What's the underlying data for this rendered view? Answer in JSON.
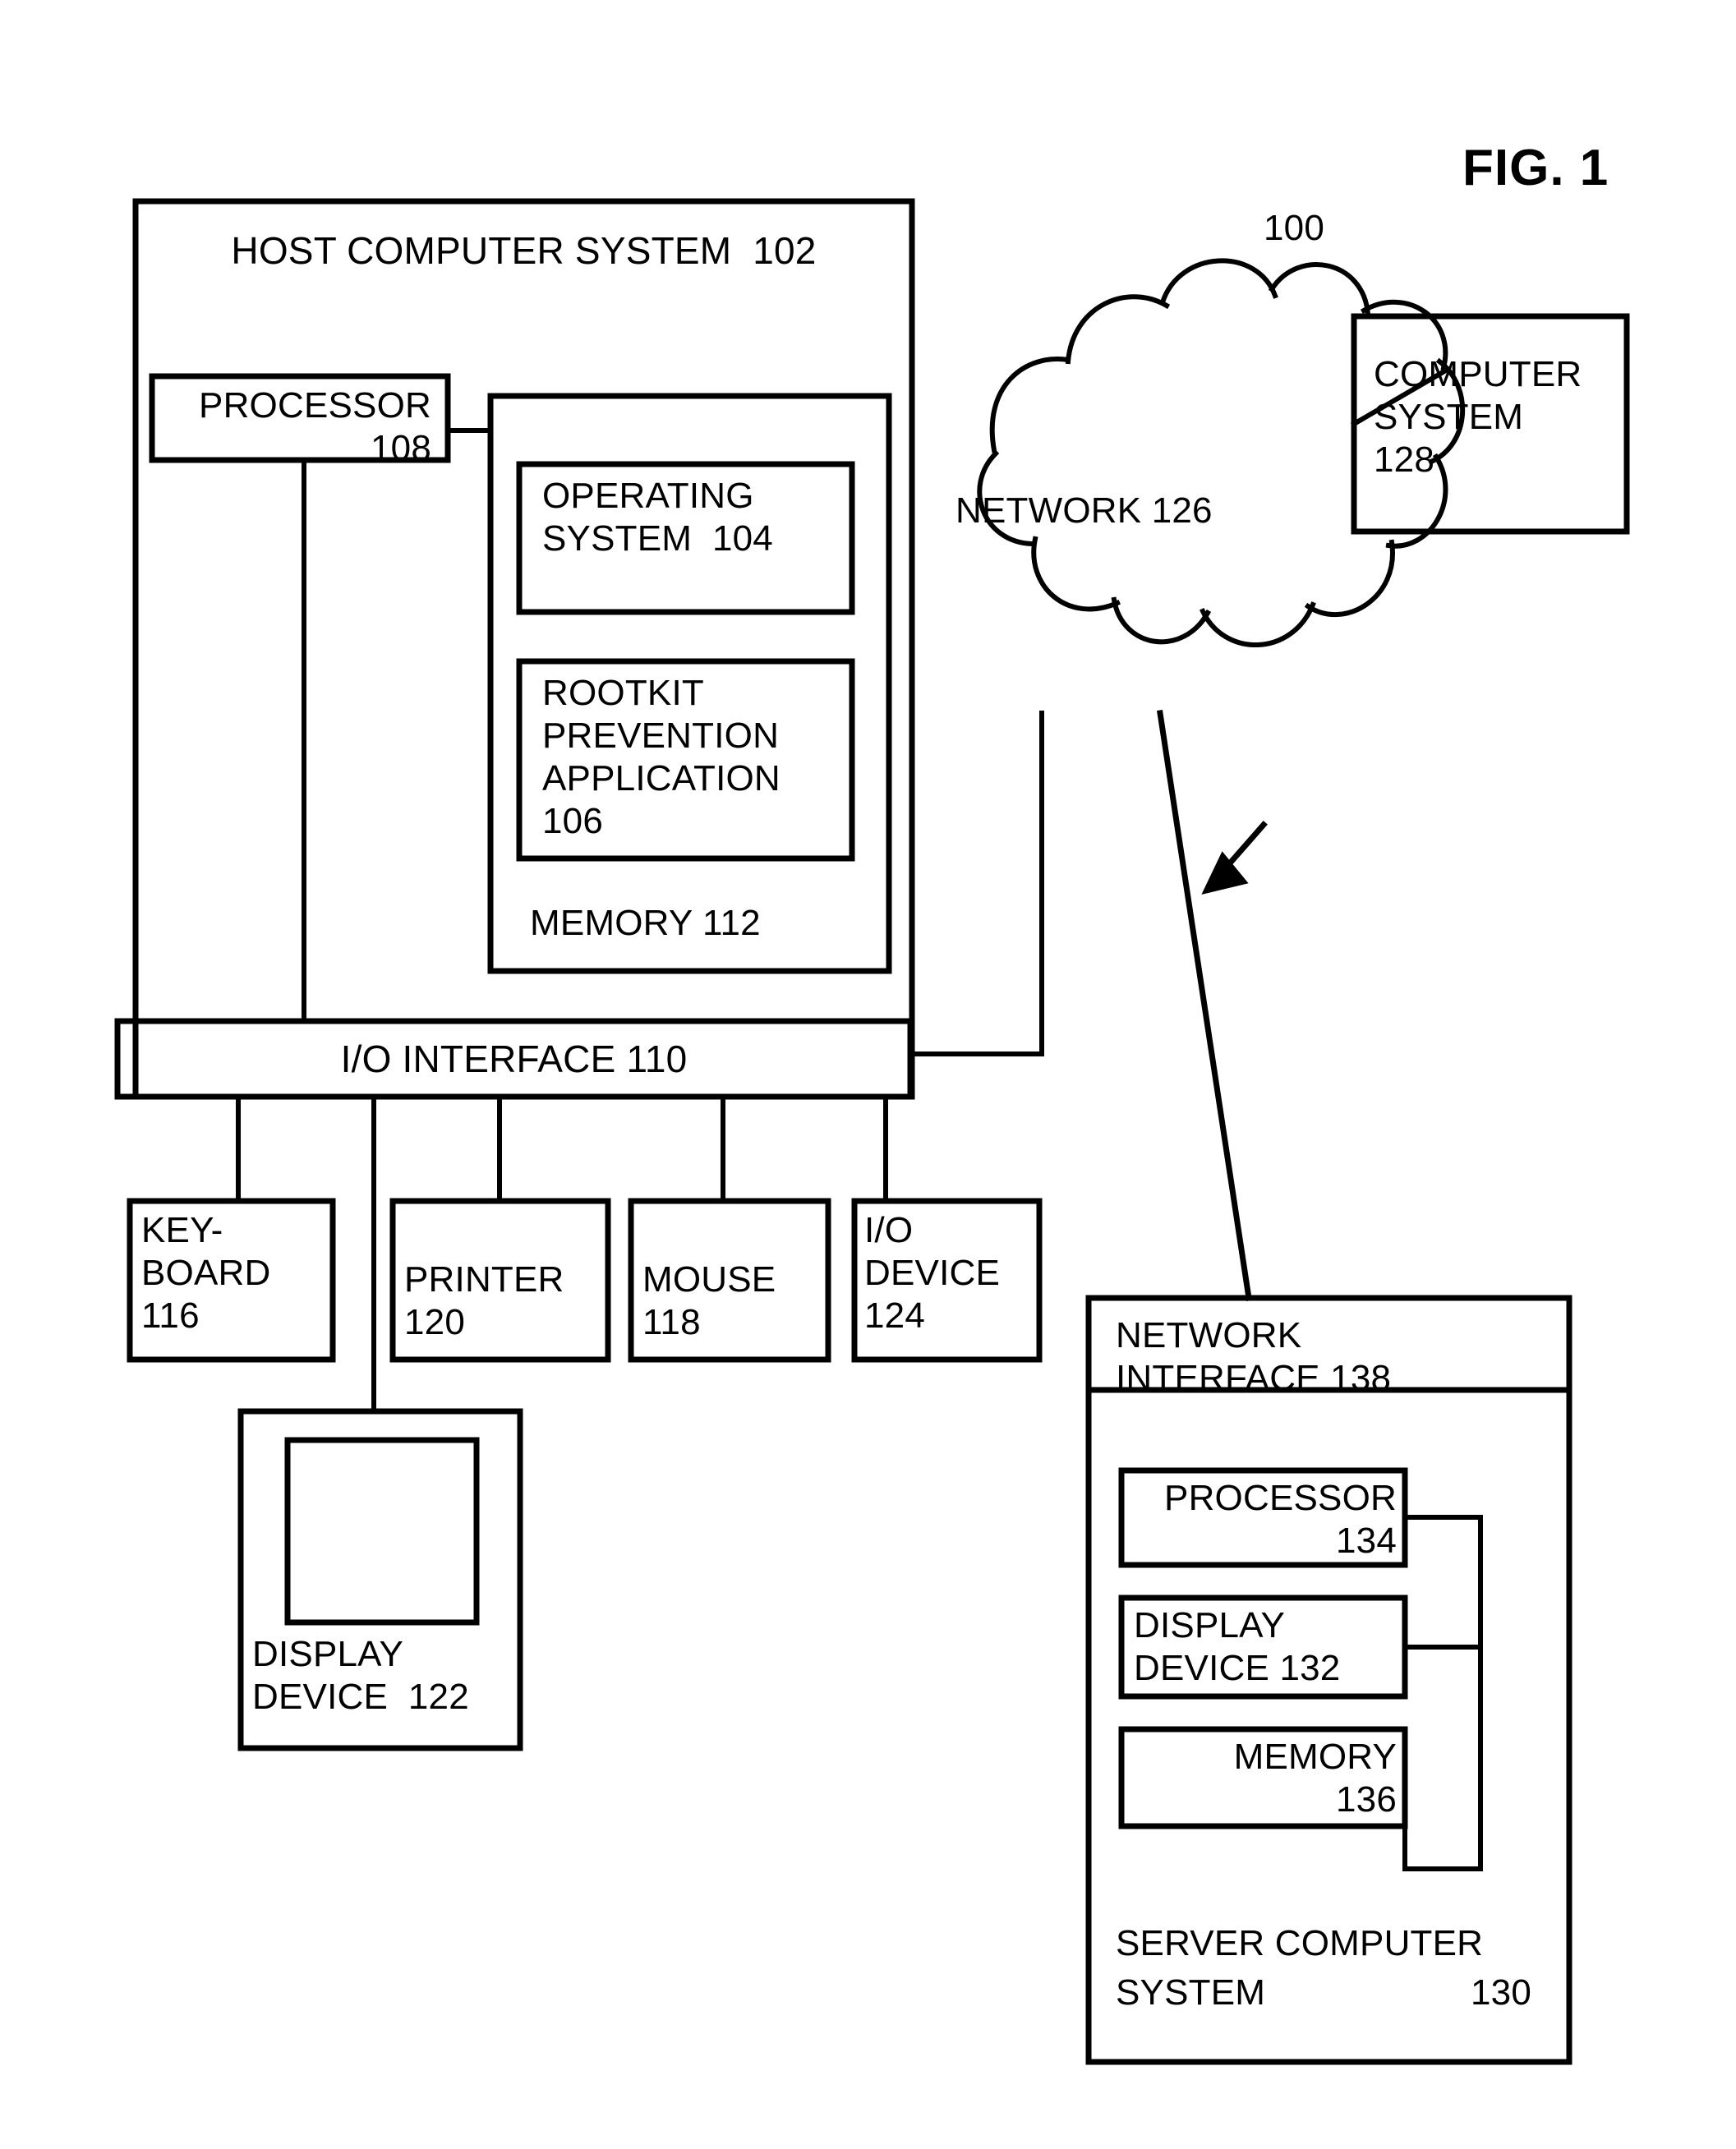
{
  "figure": {
    "title": "FIG. 1",
    "system_reference": "100"
  },
  "host_computer_system": {
    "title": "HOST COMPUTER SYSTEM  102",
    "processor": "PROCESSOR\n108",
    "memory": {
      "title": "MEMORY 112",
      "operating_system": "OPERATING\nSYSTEM  104",
      "rootkit_prevention_application": "ROOTKIT\nPREVENTION\nAPPLICATION\n106"
    },
    "io_interface": "I/O INTERFACE 110"
  },
  "peripherals": [
    {
      "name": "keyboard",
      "label": "KEY-\nBOARD\n116"
    },
    {
      "name": "printer",
      "label": "PRINTER\n120"
    },
    {
      "name": "mouse",
      "label": "MOUSE\n118"
    },
    {
      "name": "io-device",
      "label": "I/O\nDEVICE\n124"
    }
  ],
  "display_device": {
    "label": "DISPLAY\nDEVICE  122"
  },
  "network": {
    "label": "NETWORK 126"
  },
  "computer_system_128": {
    "label": "COMPUTER\nSYSTEM\n128"
  },
  "server_computer_system": {
    "network_interface": "NETWORK\nINTERFACE 138",
    "processor": "PROCESSOR\n134",
    "display_device": "DISPLAY\nDEVICE 132",
    "memory": "MEMORY\n136",
    "title_line1": "SERVER COMPUTER",
    "title_line2": "SYSTEM",
    "title_number": "130"
  },
  "style": {
    "stroke": "#000000",
    "background": "#ffffff"
  }
}
